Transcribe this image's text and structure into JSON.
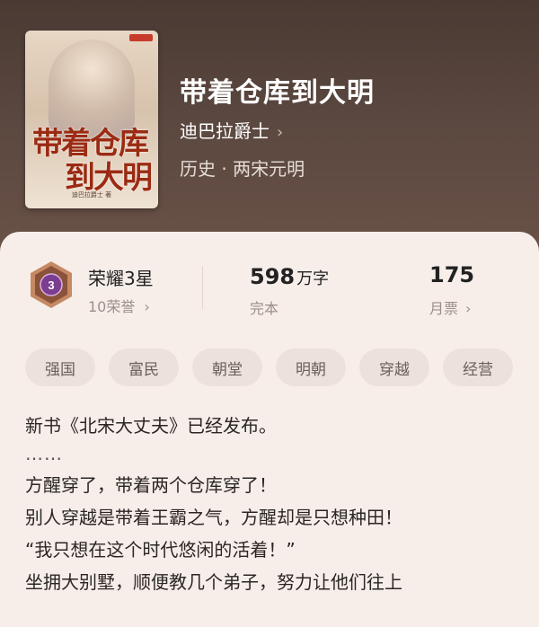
{
  "book": {
    "title": "带着仓库到大明",
    "author": "迪巴拉爵士",
    "genre": "历史 · 两宋元明",
    "cover": {
      "title_line1": "带着仓库",
      "title_line2": "到大明",
      "author_line": "迪巴拉爵士 著"
    }
  },
  "stats": {
    "honor_title": "荣耀3星",
    "honor_level": "3",
    "honor_sub": "10荣誉",
    "words_number": "598",
    "words_unit": "万字",
    "status": "完本",
    "monthly_tickets": "175",
    "monthly_label": "月票"
  },
  "tags": [
    "强国",
    "富民",
    "朝堂",
    "明朝",
    "穿越",
    "经营"
  ],
  "description": {
    "line1": "新书《北宋大丈夫》已经发布。",
    "dots": "……",
    "line2": "方醒穿了，带着两个仓库穿了！",
    "line3": "别人穿越是带着王霸之气，方醒却是只想种田！",
    "line4": "“我只想在这个时代悠闲的活着！”",
    "line5": "坐拥大别墅，顺便教几个弟子，努力让他们往上"
  },
  "colors": {
    "hero_bg": "#5b4840",
    "panel_bg": "#f7eeea",
    "tag_bg": "#ede1dc",
    "badge_purple": "#7b3d8f"
  }
}
